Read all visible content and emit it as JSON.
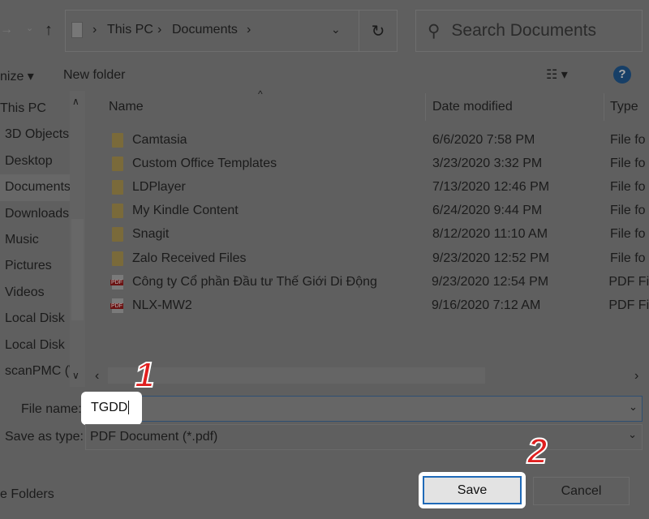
{
  "toolbar": {
    "breadcrumb": [
      "This PC",
      "Documents"
    ],
    "search_placeholder": "Search Documents",
    "organize": "nize ▾",
    "new_folder": "New folder",
    "help": "?"
  },
  "nav": {
    "items": [
      "This PC",
      "3D Objects",
      "Desktop",
      "Documents",
      "Downloads",
      "Music",
      "Pictures",
      "Videos",
      "Local Disk",
      "Local Disk",
      "scanPMC (\\"
    ]
  },
  "columns": {
    "name": "Name",
    "date": "Date modified",
    "type": "Type"
  },
  "files": [
    {
      "name": "Camtasia",
      "date": "6/6/2020 7:58 PM",
      "type": "File fo",
      "icon": "folder-icon"
    },
    {
      "name": "Custom Office Templates",
      "date": "3/23/2020 3:32 PM",
      "type": "File fo",
      "icon": "folder-icon"
    },
    {
      "name": "LDPlayer",
      "date": "7/13/2020 12:46 PM",
      "type": "File fo",
      "icon": "folder-icon"
    },
    {
      "name": "My Kindle Content",
      "date": "6/24/2020 9:44 PM",
      "type": "File fo",
      "icon": "folder-icon"
    },
    {
      "name": "Snagit",
      "date": "8/12/2020 11:10 AM",
      "type": "File fo",
      "icon": "folder-icon"
    },
    {
      "name": "Zalo Received Files",
      "date": "9/23/2020 12:52 PM",
      "type": "File fo",
      "icon": "folder-icon"
    },
    {
      "name": "Công ty Cổ phần Đầu tư Thế Giới Di Động",
      "date": "9/23/2020 12:54 PM",
      "type": "PDF Fi",
      "icon": "pdf-icon"
    },
    {
      "name": "NLX-MW2",
      "date": "9/16/2020 7:12 AM",
      "type": "PDF Fi",
      "icon": "pdf-icon"
    }
  ],
  "form": {
    "file_name_label": "File name:",
    "file_name_value": "TGDD",
    "type_label": "Save as type:",
    "type_value": "PDF Document (*.pdf)"
  },
  "footer": {
    "hide_folders": "e Folders",
    "save": "Save",
    "cancel": "Cancel"
  },
  "annotations": {
    "step1": "1",
    "step2": "2"
  },
  "colors": {
    "overlay": "#5f5f5f",
    "highlight": "#ffffff",
    "step_number": "#e01f1f",
    "focus_border": "#1f6ab8"
  }
}
